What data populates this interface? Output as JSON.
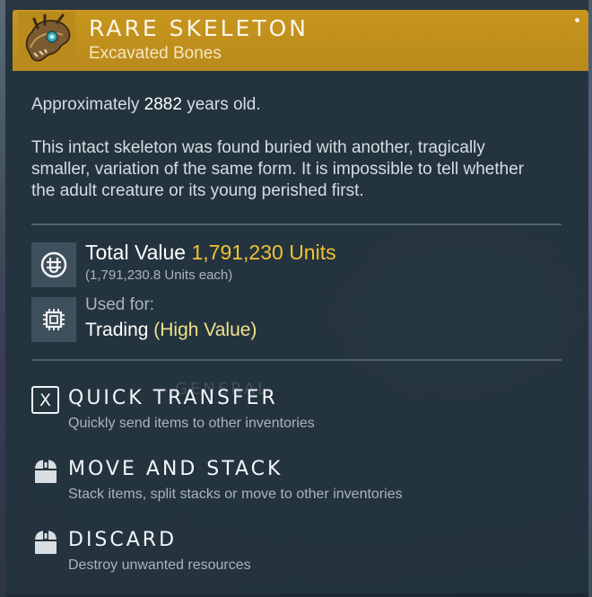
{
  "header": {
    "title": "RARE SKELETON",
    "subtitle": "Excavated Bones",
    "item_icon": "dinosaur-skull-icon",
    "accent_color": "#c8961d"
  },
  "details": {
    "age_prefix": "Approximately ",
    "age_value": "2882",
    "age_suffix": " years old.",
    "description": "This intact skeleton was found buried with another, tragically smaller, variation of the same form. It is impossible to tell whether the adult creature or its young perished first."
  },
  "value": {
    "icon": "units-currency-icon",
    "label": "Total Value ",
    "amount": "1,791,230 Units",
    "each": "(1,791,230.8 Units each)",
    "highlight_color": "#f1c233"
  },
  "usage": {
    "icon": "chip-icon",
    "label": "Used for:",
    "value": "Trading ",
    "qualifier": "(High Value)"
  },
  "background": {
    "ghost_text": "GENERAL"
  },
  "actions": [
    {
      "icon": "x-key-icon",
      "key": "X",
      "title": "QUICK TRANSFER",
      "description": "Quickly send items to other inventories"
    },
    {
      "icon": "mouse-button-icon",
      "title": "MOVE AND STACK",
      "description": "Stack items, split stacks or move to other inventories"
    },
    {
      "icon": "mouse-button-icon",
      "title": "DISCARD",
      "description": "Destroy unwanted resources"
    }
  ]
}
